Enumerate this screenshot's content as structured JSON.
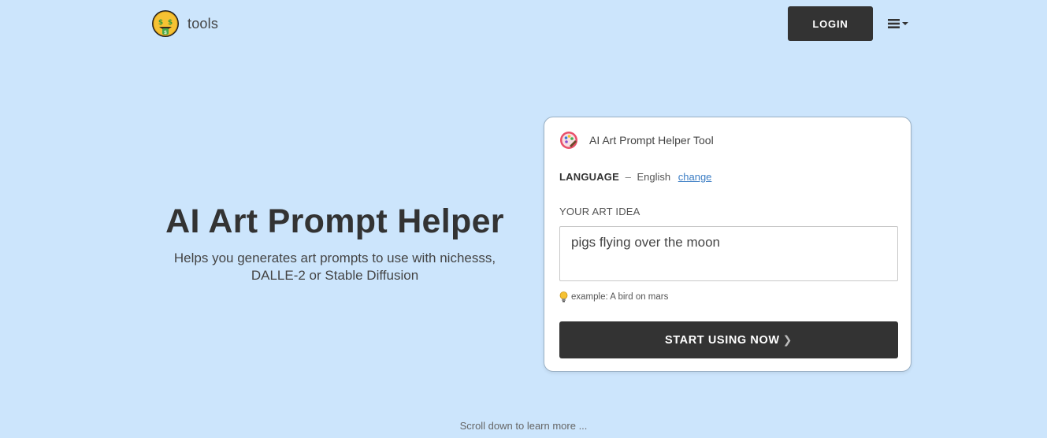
{
  "header": {
    "logo_text": "tools",
    "login_label": "LOGIN",
    "menu_icon": "hamburger-menu-icon"
  },
  "hero": {
    "title": "AI Art Prompt Helper",
    "subtitle_line1": "Helps you generates art prompts to use with nichesss,",
    "subtitle_line2": "DALLE-2 or Stable Diffusion"
  },
  "card": {
    "title": "AI Art Prompt Helper Tool",
    "language_label": "LANGUAGE",
    "language_separator": "–",
    "language_value": "English",
    "language_change": "change",
    "idea_label": "YOUR ART IDEA",
    "idea_value": "pigs flying over the moon",
    "example_text": "example: A bird on mars",
    "start_label": "START USING NOW"
  },
  "footer": {
    "scroll_hint": "Scroll down to learn more ..."
  },
  "colors": {
    "background": "#cce5fc",
    "button": "#333333",
    "link": "#3b7dc4"
  }
}
